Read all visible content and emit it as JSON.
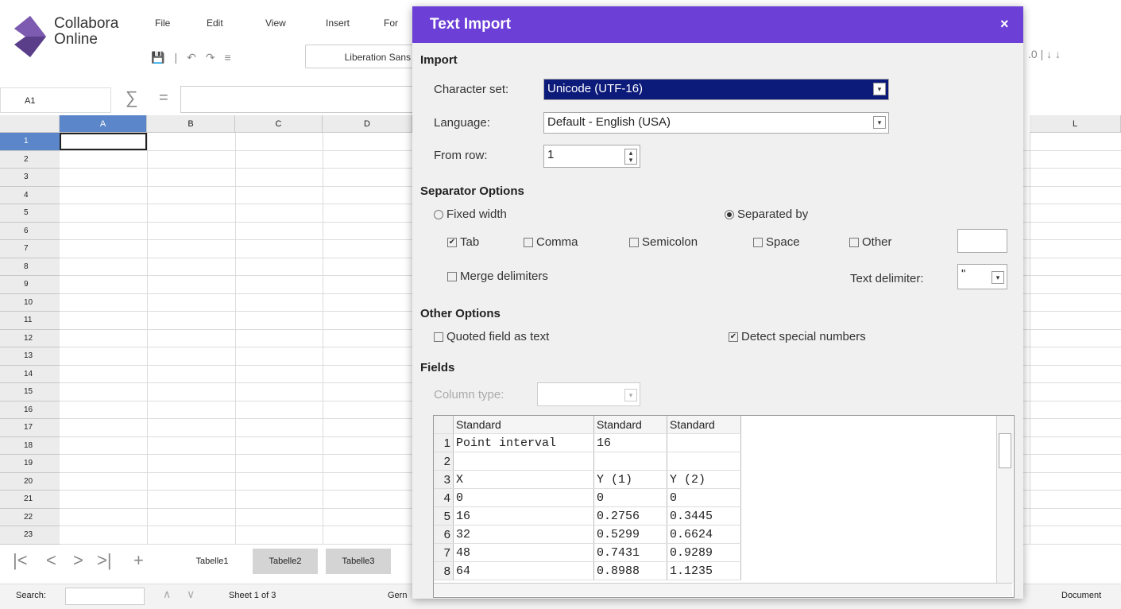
{
  "app": {
    "name_line1": "Collabora",
    "name_line2": "Online"
  },
  "menu": [
    "File",
    "Edit",
    "View",
    "Insert",
    "For"
  ],
  "toolbar": {
    "font_name": "Liberation Sans"
  },
  "formula_bar": {
    "cell_ref": "A1",
    "sum_symbol": "∑",
    "equals_symbol": "="
  },
  "grid": {
    "columns": [
      "A",
      "B",
      "C",
      "D",
      "L"
    ],
    "rows": [
      "1",
      "2",
      "3",
      "4",
      "5",
      "6",
      "7",
      "8",
      "9",
      "10",
      "11",
      "12",
      "13",
      "14",
      "15",
      "16",
      "17",
      "18",
      "19",
      "20",
      "21",
      "22",
      "23"
    ]
  },
  "sheets": {
    "nav": [
      "|<",
      "<",
      ">",
      ">|",
      "+"
    ],
    "tabs": [
      "Tabelle1",
      "Tabelle2",
      "Tabelle3"
    ]
  },
  "statusbar": {
    "search_label": "Search:",
    "sheet_info": "Sheet 1 of 3",
    "lang_partial": "Gern",
    "right_partial": "Document"
  },
  "dialog": {
    "title": "Text Import",
    "close": "×",
    "import_section": "Import",
    "charset_label": "Character set:",
    "charset_value": "Unicode (UTF-16)",
    "language_label": "Language:",
    "language_value": "Default - English (USA)",
    "fromrow_label": "From row:",
    "fromrow_value": "1",
    "separator_section": "Separator Options",
    "fixed_width": "Fixed width",
    "separated_by": "Separated by",
    "tab": "Tab",
    "comma": "Comma",
    "semicolon": "Semicolon",
    "space": "Space",
    "other": "Other",
    "merge": "Merge delimiters",
    "text_delim_label": "Text delimiter:",
    "text_delim_value": "\"",
    "other_section": "Other Options",
    "quoted": "Quoted field as text",
    "detect": "Detect special numbers",
    "fields_section": "Fields",
    "column_type_label": "Column type:",
    "preview": {
      "headers": [
        "Standard",
        "Standard",
        "Standard"
      ],
      "rows": [
        [
          "1",
          "Point interval",
          "16",
          ""
        ],
        [
          "2",
          "",
          "",
          ""
        ],
        [
          "3",
          "X",
          "Y (1)",
          "Y (2)"
        ],
        [
          "4",
          "0",
          "0",
          "0"
        ],
        [
          "5",
          "16",
          "0.2756",
          "0.3445"
        ],
        [
          "6",
          "32",
          "0.5299",
          "0.6624"
        ],
        [
          "7",
          "48",
          "0.7431",
          "0.9289"
        ],
        [
          "8",
          "64",
          "0.8988",
          "1.1235"
        ]
      ]
    }
  }
}
